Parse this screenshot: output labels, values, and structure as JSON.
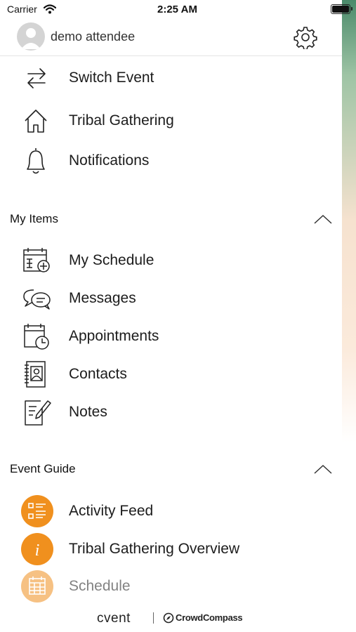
{
  "status_bar": {
    "carrier": "Carrier",
    "time": "2:25 AM"
  },
  "profile": {
    "name": "demo attendee"
  },
  "top_nav": [
    {
      "label": "Switch Event",
      "icon": "switch-arrows-icon"
    },
    {
      "label": "Tribal Gathering",
      "icon": "home-icon"
    },
    {
      "label": "Notifications",
      "icon": "bell-icon"
    }
  ],
  "my_items": {
    "title": "My Items",
    "items": [
      {
        "label": "My Schedule",
        "icon": "calendar-add-icon"
      },
      {
        "label": "Messages",
        "icon": "chat-bubbles-icon"
      },
      {
        "label": "Appointments",
        "icon": "calendar-clock-icon"
      },
      {
        "label": "Contacts",
        "icon": "contact-book-icon"
      },
      {
        "label": "Notes",
        "icon": "note-pencil-icon"
      }
    ]
  },
  "event_guide": {
    "title": "Event Guide",
    "items": [
      {
        "label": "Activity Feed",
        "icon": "activity-feed-icon"
      },
      {
        "label": "Tribal Gathering Overview",
        "icon": "info-icon"
      },
      {
        "label": "Schedule",
        "icon": "schedule-grid-icon"
      }
    ]
  },
  "footer": {
    "brand": "cvent",
    "partner": "CrowdCompass"
  },
  "colors": {
    "accent_orange": "#f0901e",
    "text": "#1c1c1c",
    "divider": "#e3e3e3"
  }
}
